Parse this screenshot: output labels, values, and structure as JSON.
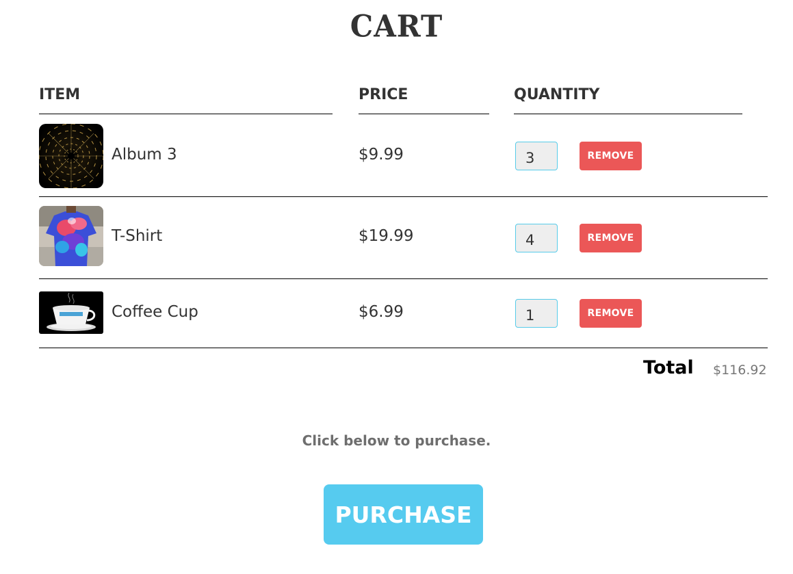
{
  "page": {
    "title": "CART"
  },
  "columns": {
    "item": "ITEM",
    "price": "PRICE",
    "quantity": "QUANTITY"
  },
  "items": [
    {
      "name": "Album 3",
      "price": "$9.99",
      "quantity": "3",
      "remove_label": "REMOVE",
      "image": "album-cover-image"
    },
    {
      "name": "T-Shirt",
      "price": "$19.99",
      "quantity": "4",
      "remove_label": "REMOVE",
      "image": "tshirt-image"
    },
    {
      "name": "Coffee Cup",
      "price": "$6.99",
      "quantity": "1",
      "remove_label": "REMOVE",
      "image": "coffee-cup-image"
    }
  ],
  "total": {
    "label": "Total",
    "value": "$116.92"
  },
  "purchase": {
    "prompt": "Click below to purchase.",
    "button_label": "PURCHASE"
  },
  "colors": {
    "remove_button": "#eb5757",
    "purchase_button": "#56cbef",
    "input_border": "#56cbe9",
    "text": "#333333"
  }
}
